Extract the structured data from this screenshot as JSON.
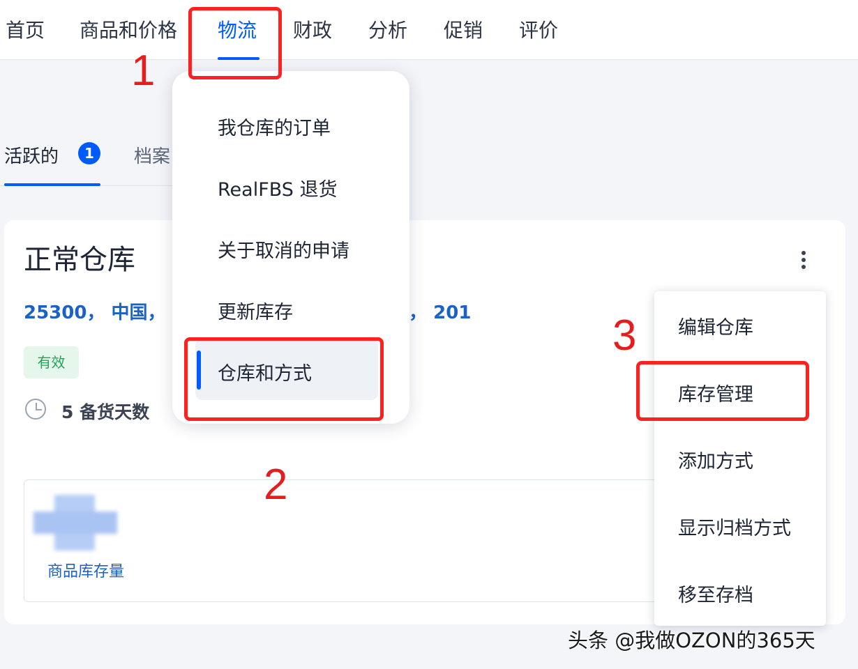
{
  "topnav": {
    "items": [
      "首页",
      "商品和价格",
      "物流",
      "财政",
      "分析",
      "促销",
      "评价"
    ],
    "active_index": 2
  },
  "tabs": {
    "active": "活跃的",
    "active_count": "1",
    "second": "档案"
  },
  "warehouse": {
    "title": "正常仓库",
    "address_start": "25300， 中国，",
    "address_end": "3， 201",
    "status": "有效",
    "days": "5 备货天数",
    "stock_label": "商品库存量"
  },
  "logistics_menu": {
    "items": [
      "我仓库的订单",
      "RealFBS 退货",
      "关于取消的申请",
      "更新库存",
      "仓库和方式"
    ],
    "selected": "仓库和方式"
  },
  "warehouse_menu": {
    "items": [
      "编辑仓库",
      "库存管理",
      "添加方式",
      "显示归档方式",
      "移至存档"
    ]
  },
  "annotations": {
    "step1": "1",
    "step2": "2",
    "step3": "3",
    "color": "#ff2020"
  },
  "watermark": "头条 @我做OZON的365天",
  "colors": {
    "accent": "#005bff",
    "link": "#1a62c8",
    "status_green": "#23a35a"
  }
}
